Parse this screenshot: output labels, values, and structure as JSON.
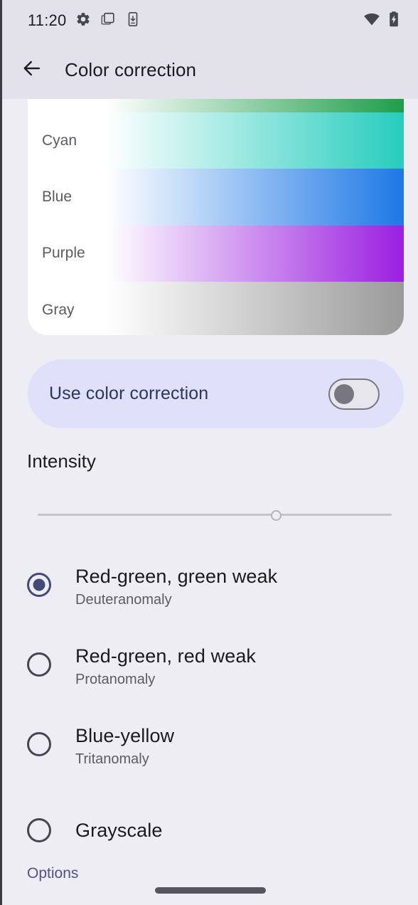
{
  "status_bar": {
    "clock": "11:20",
    "left_icons": [
      "gear-icon",
      "copy-icon",
      "phone-download-icon"
    ],
    "right_icons": [
      "wifi-icon",
      "battery-charging-icon"
    ]
  },
  "app_bar": {
    "back_icon": "arrow-back-icon",
    "title": "Color correction"
  },
  "preview": {
    "rows": [
      {
        "label": "",
        "color": "#1e9e4a",
        "name": "green"
      },
      {
        "label": "Cyan",
        "color": "#27ccbd",
        "name": "cyan"
      },
      {
        "label": "Blue",
        "color": "#1e78e6",
        "name": "blue"
      },
      {
        "label": "Purple",
        "color": "#9b1fe0",
        "name": "purple"
      },
      {
        "label": "Gray",
        "color": "#9a9a9a",
        "name": "gray"
      }
    ]
  },
  "toggle": {
    "label": "Use color correction",
    "checked": false,
    "card_color": "#dfe1f9",
    "label_color": "#2f3361"
  },
  "intensity": {
    "title": "Intensity",
    "value_percent": 66,
    "enabled": false
  },
  "modes": {
    "selected_index": 0,
    "items": [
      {
        "title": "Red-green, green weak",
        "subtitle": "Deuteranomaly"
      },
      {
        "title": "Red-green, red weak",
        "subtitle": "Protanomaly"
      },
      {
        "title": "Blue-yellow",
        "subtitle": "Tritanomaly"
      },
      {
        "title": "Grayscale",
        "subtitle": ""
      }
    ]
  },
  "footer": {
    "options_label": "Options",
    "options_color": "#4e5487"
  },
  "theme": {
    "background": "#eeedf4",
    "app_bar_background": "#e3e2ea",
    "accent": "#424b77",
    "text_primary": "#1b1b1f",
    "text_secondary": "#5b5b61"
  }
}
